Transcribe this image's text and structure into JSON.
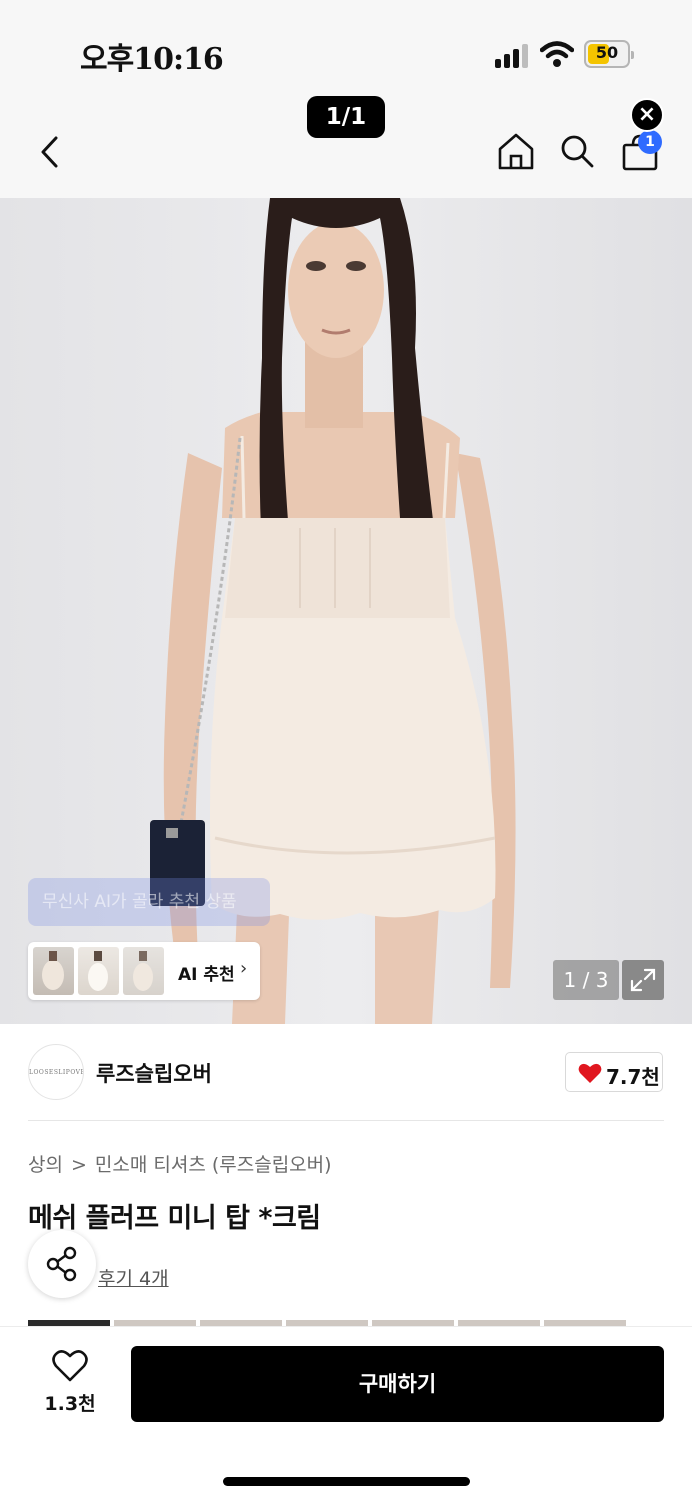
{
  "status_bar": {
    "time": "오후10:16",
    "battery": "50"
  },
  "viewer": {
    "page_indicator": "1/1",
    "close_label": "×"
  },
  "nav": {
    "cart_count": "1"
  },
  "gallery": {
    "ai_banner": "무신사 AI가 골라 추천 상품",
    "ai_recommend_label": "AI 추천",
    "image_counter": "1 / 3",
    "current_image": 1,
    "total_images": 3
  },
  "brand": {
    "logo_text": "LOOSESLIPOVER",
    "name": "루즈슬립오버",
    "like_count": "7.7천"
  },
  "product": {
    "breadcrumb": [
      "상의",
      "민소매 티셔츠 (루즈슬립오버)"
    ],
    "breadcrumb_separator": ">",
    "title": "메쉬 플러프 미니 탑 *크림",
    "review_link": "후기 4개"
  },
  "bottom_bar": {
    "wish_count": "1.3천",
    "buy_label": "구매하기"
  },
  "colors": {
    "accent_blue": "#2f6bff",
    "heart_red": "#e0161f",
    "buy_button": "#000000"
  }
}
